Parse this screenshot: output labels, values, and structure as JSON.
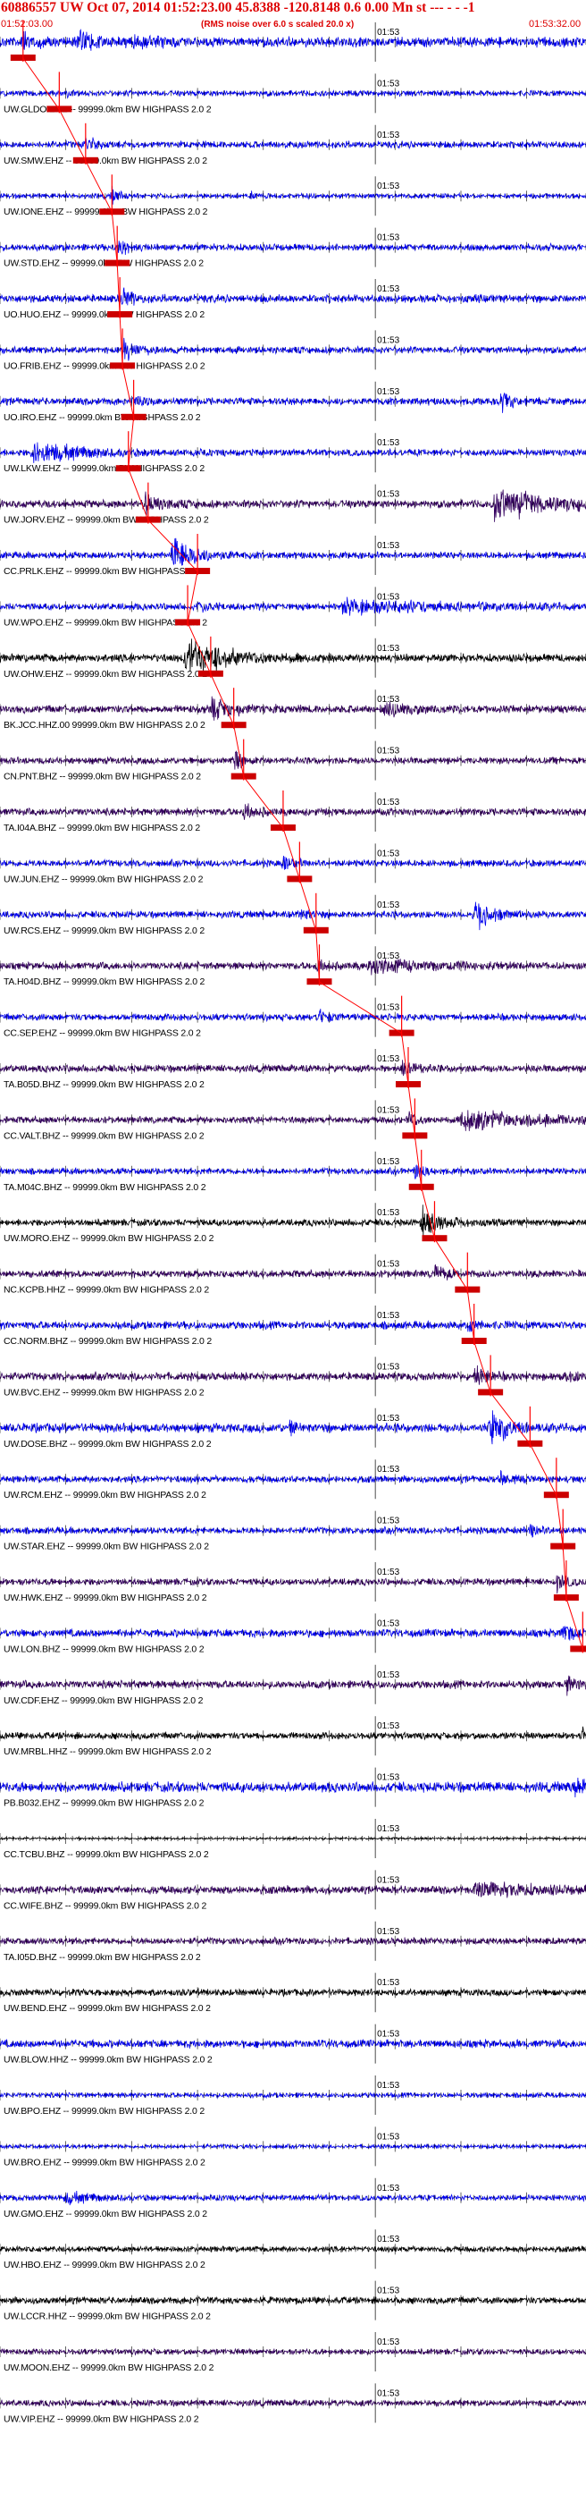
{
  "header": {
    "title": "60886557 UW Oct 07, 2014 01:52:23.00   45.8388 -120.8148  0.6 0.00 Mn st --- - - -1",
    "start_time": "01:52:03.00",
    "note": "(RMS noise over 6.0 s scaled 20.0 x)",
    "end_time": "01:53:32.00"
  },
  "chart_data": {
    "type": "line",
    "title": "60886557 UW Oct 07, 2014 01:52:23.00   45.8388 -120.8148  0.6 0.00 Mn st --- - - -1",
    "x_range_s": [
      0,
      89
    ],
    "minute_mark": {
      "label": "01:53",
      "t": 57
    },
    "colors": {
      "blue": "#0000ee",
      "purple": "#33005e",
      "black": "#000000",
      "pick": "#ff0000",
      "pick_box": "#cc0000"
    },
    "pick_times": [
      3.5,
      9,
      13,
      17,
      17.8,
      18.2,
      18.6,
      20.3,
      19.5,
      22.5,
      30,
      28.5,
      32,
      35.5,
      37,
      43,
      45.5,
      48,
      48.5,
      61,
      62,
      63,
      64,
      66,
      71,
      72,
      74.5,
      80.5,
      84.5,
      85.5,
      86,
      88.5
    ],
    "channels": [
      {
        "label": "",
        "color": "blue",
        "noise": 0.45,
        "events": [
          {
            "t": 3.5,
            "a": 0.9,
            "d": 3
          },
          {
            "t": 12,
            "a": 0.8,
            "d": 6
          },
          {
            "t": 20,
            "a": 0.5,
            "d": 6
          }
        ]
      },
      {
        "label": "UW.GLDO.EHZ -- 99999.0km BW  HIGHPASS  2.0  2",
        "color": "blue",
        "noise": 0.25,
        "events": [
          {
            "t": 10,
            "a": 0.6,
            "d": 1
          }
        ]
      },
      {
        "label": "UW.SMW.EHZ -- 99999.0km BW  HIGHPASS  2.0  2",
        "color": "blue",
        "noise": 0.3,
        "events": [
          {
            "t": 13,
            "a": 0.8,
            "d": 3
          }
        ]
      },
      {
        "label": "UW.IONE.EHZ -- 99999.0km BW  HIGHPASS  2.0  2",
        "color": "blue",
        "noise": 0.22,
        "events": [
          {
            "t": 17,
            "a": 0.7,
            "d": 3
          },
          {
            "t": 38,
            "a": 0.5,
            "d": 1.2
          }
        ]
      },
      {
        "label": "UW.STD.EHZ -- 99999.0km BW  HIGHPASS  2.0  2",
        "color": "blue",
        "noise": 0.3,
        "events": [
          {
            "t": 18,
            "a": 0.8,
            "d": 3
          }
        ]
      },
      {
        "label": "UO.HUO.EHZ -- 99999.0km BW  HIGHPASS  2.0  2",
        "color": "blue",
        "noise": 0.35,
        "events": [
          {
            "t": 18.5,
            "a": 1.0,
            "d": 3
          }
        ]
      },
      {
        "label": "UO.FRIB.EHZ -- 99999.0km BW  HIGHPASS  2.0  2",
        "color": "blue",
        "noise": 0.3,
        "events": [
          {
            "t": 18.8,
            "a": 1.1,
            "d": 4
          }
        ]
      },
      {
        "label": "UO.IRO.EHZ -- 99999.0km BW  HIGHPASS  2.0  2",
        "color": "blue",
        "noise": 0.32,
        "events": [
          {
            "t": 20.5,
            "a": 0.6,
            "d": 3
          },
          {
            "t": 76,
            "a": 0.9,
            "d": 4
          }
        ]
      },
      {
        "label": "UW.LKW.EHZ -- 99999.0km BW  HIGHPASS  2.0  2",
        "color": "blue",
        "noise": 0.3,
        "events": [
          {
            "t": 5,
            "a": 1.0,
            "d": 14
          }
        ]
      },
      {
        "label": "UW.JORV.EHZ -- 99999.0km BW  HIGHPASS  2.0  2",
        "color": "purple",
        "noise": 0.35,
        "events": [
          {
            "t": 22,
            "a": 0.9,
            "d": 5
          },
          {
            "t": 75,
            "a": 1.4,
            "d": 18
          }
        ]
      },
      {
        "label": "CC.PRLK.EHZ -- 99999.0km BW  HIGHPASS  2.0  2",
        "color": "blue",
        "noise": 0.3,
        "events": [
          {
            "t": 26,
            "a": 1.6,
            "d": 8
          }
        ]
      },
      {
        "label": "UW.WPO.EHZ -- 99999.0km BW  HIGHPASS  2.0  2",
        "color": "blue",
        "noise": 0.3,
        "events": [
          {
            "t": 30,
            "a": 0.6,
            "d": 3
          },
          {
            "t": 52,
            "a": 0.6,
            "d": 35
          }
        ]
      },
      {
        "label": "UW.OHW.EHZ -- 99999.0km BW  HIGHPASS  2.0  2",
        "color": "black",
        "noise": 0.35,
        "events": [
          {
            "t": 28,
            "a": 1.6,
            "d": 14
          }
        ]
      },
      {
        "label": "BK.JCC.HHZ.00 99999.0km BW  HIGHPASS  2.0  2",
        "color": "purple",
        "noise": 0.35,
        "events": [
          {
            "t": 32,
            "a": 0.9,
            "d": 8
          },
          {
            "t": 58,
            "a": 0.6,
            "d": 8
          }
        ]
      },
      {
        "label": "CN.PNT.BHZ -- 99999.0km BW  HIGHPASS  2.0  2",
        "color": "purple",
        "noise": 0.3,
        "events": [
          {
            "t": 35.5,
            "a": 0.9,
            "d": 3
          }
        ]
      },
      {
        "label": "TA.I04A.BHZ -- 99999.0km BW  HIGHPASS  2.0  2",
        "color": "purple",
        "noise": 0.32,
        "events": [
          {
            "t": 37,
            "a": 0.8,
            "d": 3
          }
        ]
      },
      {
        "label": "UW.JUN.EHZ -- 99999.0km BW  HIGHPASS  2.0  2",
        "color": "blue",
        "noise": 0.3,
        "events": [
          {
            "t": 43,
            "a": 0.7,
            "d": 3
          }
        ]
      },
      {
        "label": "UW.RCS.EHZ -- 99999.0km BW  HIGHPASS  2.0  2",
        "color": "blue",
        "noise": 0.3,
        "events": [
          {
            "t": 45.5,
            "a": 0.6,
            "d": 3
          },
          {
            "t": 72,
            "a": 1.4,
            "d": 6
          }
        ]
      },
      {
        "label": "TA.H04D.BHZ -- 99999.0km BW  HIGHPASS  2.0  2",
        "color": "purple",
        "noise": 0.32,
        "events": [
          {
            "t": 48,
            "a": 0.5,
            "d": 3
          },
          {
            "t": 56,
            "a": 0.55,
            "d": 20
          }
        ]
      },
      {
        "label": "CC.SEP.EHZ -- 99999.0km BW  HIGHPASS  2.0  2",
        "color": "blue",
        "noise": 0.3,
        "events": [
          {
            "t": 48.5,
            "a": 0.6,
            "d": 3
          }
        ]
      },
      {
        "label": "TA.B05D.BHZ -- 99999.0km BW  HIGHPASS  2.0  2",
        "color": "purple",
        "noise": 0.32,
        "events": [
          {
            "t": 61,
            "a": 0.8,
            "d": 4
          }
        ]
      },
      {
        "label": "CC.VALT.BHZ -- 99999.0km BW  HIGHPASS  2.0  2",
        "color": "purple",
        "noise": 0.3,
        "events": [
          {
            "t": 62,
            "a": 0.8,
            "d": 3
          },
          {
            "t": 70,
            "a": 0.9,
            "d": 22
          }
        ]
      },
      {
        "label": "TA.M04C.BHZ -- 99999.0km BW  HIGHPASS  2.0  2",
        "color": "blue",
        "noise": 0.28,
        "events": [
          {
            "t": 63,
            "a": 0.7,
            "d": 3
          }
        ]
      },
      {
        "label": "UW.MORO.EHZ -- 99999.0km BW  HIGHPASS  2.0  2",
        "color": "black",
        "noise": 0.3,
        "events": [
          {
            "t": 64,
            "a": 1.3,
            "d": 6
          }
        ]
      },
      {
        "label": "NC.KCPB.HHZ -- 99999.0km BW  HIGHPASS  2.0  2",
        "color": "purple",
        "noise": 0.32,
        "events": [
          {
            "t": 66,
            "a": 0.7,
            "d": 4
          }
        ]
      },
      {
        "label": "CC.NORM.BHZ -- 99999.0km BW  HIGHPASS  2.0  2",
        "color": "blue",
        "noise": 0.35,
        "events": [
          {
            "t": 71,
            "a": 0.6,
            "d": 3
          }
        ]
      },
      {
        "label": "UW.BVC.EHZ -- 99999.0km BW  HIGHPASS  2.0  2",
        "color": "purple",
        "noise": 0.35,
        "events": [
          {
            "t": 72,
            "a": 0.8,
            "d": 4
          },
          {
            "t": 86,
            "a": 0.5,
            "d": 3
          }
        ]
      },
      {
        "label": "UW.DOSE.BHZ -- 99999.0km BW  HIGHPASS  2.0  2",
        "color": "blue",
        "noise": 0.4,
        "events": [
          {
            "t": 74.5,
            "a": 1.8,
            "d": 5
          },
          {
            "t": 44,
            "a": 0.6,
            "d": 2
          }
        ]
      },
      {
        "label": "UW.RCM.EHZ -- 99999.0km BW  HIGHPASS  2.0  2",
        "color": "blue",
        "noise": 0.3,
        "events": [
          {
            "t": 76,
            "a": 0.6,
            "d": 3
          }
        ]
      },
      {
        "label": "UW.STAR.EHZ -- 99999.0km BW  HIGHPASS  2.0  2",
        "color": "blue",
        "noise": 0.3,
        "events": [
          {
            "t": 80.5,
            "a": 0.6,
            "d": 3
          }
        ]
      },
      {
        "label": "UW.HWK.EHZ -- 99999.0km BW  HIGHPASS  2.0  2",
        "color": "purple",
        "noise": 0.3,
        "events": [
          {
            "t": 84.5,
            "a": 0.8,
            "d": 3
          }
        ]
      },
      {
        "label": "UW.LON.BHZ -- 99999.0km BW  HIGHPASS  2.0  2",
        "color": "blue",
        "noise": 0.35,
        "events": [
          {
            "t": 85.5,
            "a": 0.8,
            "d": 3
          }
        ]
      },
      {
        "label": "UW.CDF.EHZ -- 99999.0km BW  HIGHPASS  2.0  2",
        "color": "purple",
        "noise": 0.35,
        "events": [
          {
            "t": 86,
            "a": 0.8,
            "d": 3
          }
        ]
      },
      {
        "label": "UW.MRBL.HHZ -- 99999.0km BW  HIGHPASS  2.0  2",
        "color": "black",
        "noise": 0.3,
        "events": [
          {
            "t": 88.5,
            "a": 0.7,
            "d": 2
          }
        ]
      },
      {
        "label": "PB.B032.EHZ -- 99999.0km BW  HIGHPASS  2.0  2",
        "color": "blue",
        "noise": 0.45,
        "events": [
          {
            "t": 87,
            "a": 0.8,
            "d": 5
          }
        ]
      },
      {
        "label": "CC.TCBU.BHZ -- 99999.0km BW  HIGHPASS  2.0  2",
        "color": "black",
        "noise": 0.1,
        "events": []
      },
      {
        "label": "CC.WIFE.BHZ -- 99999.0km BW  HIGHPASS  2.0  2",
        "color": "purple",
        "noise": 0.35,
        "events": [
          {
            "t": 72,
            "a": 0.6,
            "d": 20
          }
        ]
      },
      {
        "label": "TA.I05D.BHZ -- 99999.0km BW  HIGHPASS  2.0  2",
        "color": "purple",
        "noise": 0.3,
        "events": []
      },
      {
        "label": "UW.BEND.EHZ -- 99999.0km BW  HIGHPASS  2.0  2",
        "color": "black",
        "noise": 0.3,
        "events": []
      },
      {
        "label": "UW.BLOW.HHZ -- 99999.0km BW  HIGHPASS  2.0  2",
        "color": "blue",
        "noise": 0.35,
        "events": []
      },
      {
        "label": "UW.BPO.EHZ -- 99999.0km BW  HIGHPASS  2.0  2",
        "color": "blue",
        "noise": 0.22,
        "events": []
      },
      {
        "label": "UW.BRO.EHZ -- 99999.0km BW  HIGHPASS  2.0  2",
        "color": "blue",
        "noise": 0.18,
        "events": []
      },
      {
        "label": "UW.GMO.EHZ -- 99999.0km BW  HIGHPASS  2.0  2",
        "color": "blue",
        "noise": 0.25,
        "events": [
          {
            "t": 10,
            "a": 0.5,
            "d": 8
          }
        ]
      },
      {
        "label": "UW.HBO.EHZ -- 99999.0km BW  HIGHPASS  2.0  2",
        "color": "black",
        "noise": 0.25,
        "events": []
      },
      {
        "label": "UW.LCCR.HHZ -- 99999.0km BW  HIGHPASS  2.0  2",
        "color": "black",
        "noise": 0.3,
        "events": []
      },
      {
        "label": "UW.MOON.EHZ -- 99999.0km BW  HIGHPASS  2.0  2",
        "color": "purple",
        "noise": 0.25,
        "events": []
      },
      {
        "label": "UW.VIP.EHZ -- 99999.0km BW  HIGHPASS  2.0  2",
        "color": "purple",
        "noise": 0.28,
        "events": []
      }
    ]
  }
}
